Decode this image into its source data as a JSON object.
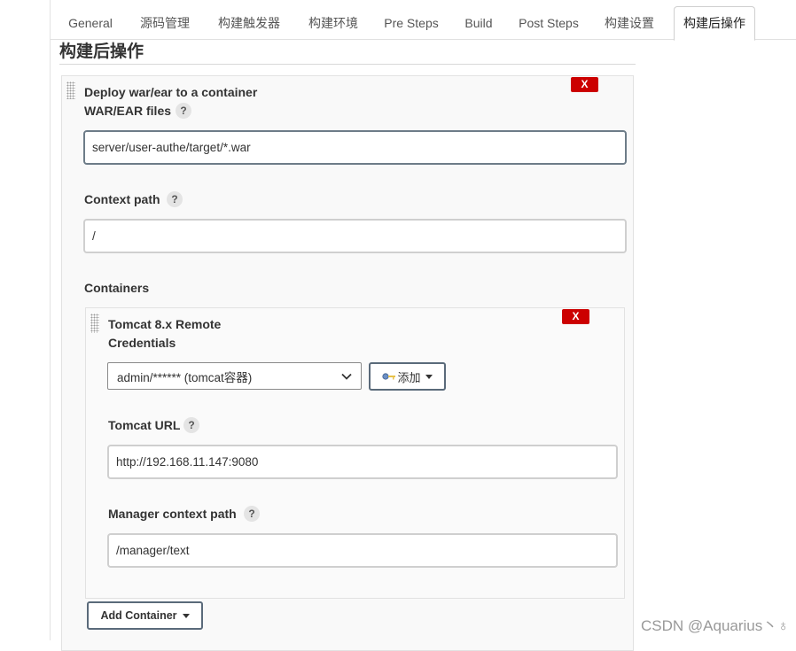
{
  "tabs": [
    {
      "label": "General"
    },
    {
      "label": "源码管理"
    },
    {
      "label": "构建触发器"
    },
    {
      "label": "构建环境"
    },
    {
      "label": "Pre Steps"
    },
    {
      "label": "Build"
    },
    {
      "label": "Post Steps"
    },
    {
      "label": "构建设置"
    },
    {
      "label": "构建后操作",
      "active": true
    }
  ],
  "section_title": "构建后操作",
  "deploy": {
    "title": "Deploy war/ear to a container",
    "delete_label": "X",
    "help_label": "?",
    "war_files": {
      "label": "WAR/EAR files",
      "value": "server/user-authe/target/*.war"
    },
    "context_path": {
      "label": "Context path",
      "value": "/"
    },
    "containers_label": "Containers",
    "add_container_label": "Add Container"
  },
  "tomcat": {
    "title": "Tomcat 8.x Remote",
    "delete_label": "X",
    "credentials": {
      "label": "Credentials",
      "selected": "admin/****** (tomcat容器)",
      "add_label": "添加"
    },
    "url": {
      "label": "Tomcat URL",
      "value": "http://192.168.11.147:9080"
    },
    "manager_path": {
      "label": "Manager context path",
      "value": "/manager/text"
    }
  },
  "watermark": "CSDN @Aquarius丶♁",
  "colors": {
    "delete": "#cc0000",
    "focus_border": "#6d7c88",
    "panel_bg": "#f9f9f9"
  },
  "icons": {
    "credentials_add": "key-icon",
    "dropdown": "caret-down-icon",
    "drag": "drag-handle-icon"
  }
}
